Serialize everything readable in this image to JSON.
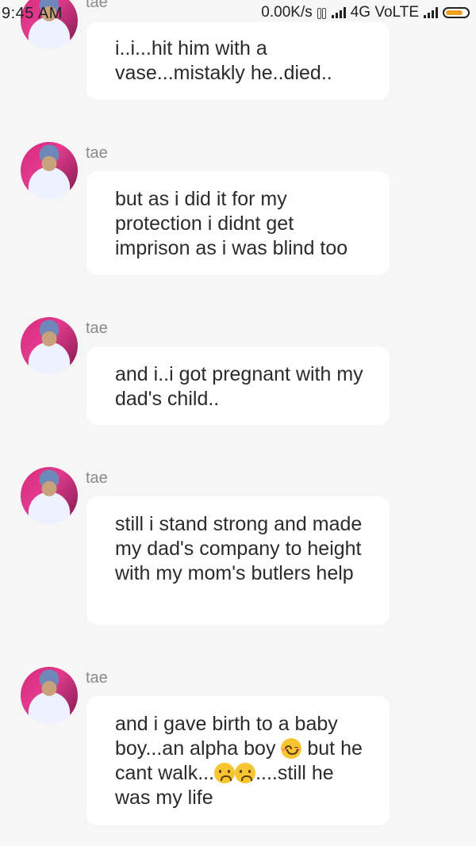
{
  "status_bar": {
    "time": "9:45 AM",
    "network_speed": "0.00K/s",
    "network_type": "4G VoLTE",
    "battery_color": "#f0a020"
  },
  "messages": [
    {
      "sender": "tae",
      "text": "i..i...hit him with a vase...mistakly he..died.."
    },
    {
      "sender": "tae",
      "text": "but as i did it for my protection i didnt get imprison as i was blind too"
    },
    {
      "sender": "tae",
      "text": "and i..i got pregnant with my dad's child.."
    },
    {
      "sender": "tae",
      "text": "still i stand strong and made my dad's company to height with my mom's butlers help"
    },
    {
      "sender": "tae",
      "text_parts": [
        "and i gave birth to a baby boy...an alpha boy",
        " but he cant walk...",
        "....still he was my life"
      ]
    }
  ],
  "icons": [
    "vibrate-icon",
    "signal-icon",
    "battery-icon",
    "smiling-emoji-icon",
    "sad-emoji-icon"
  ]
}
